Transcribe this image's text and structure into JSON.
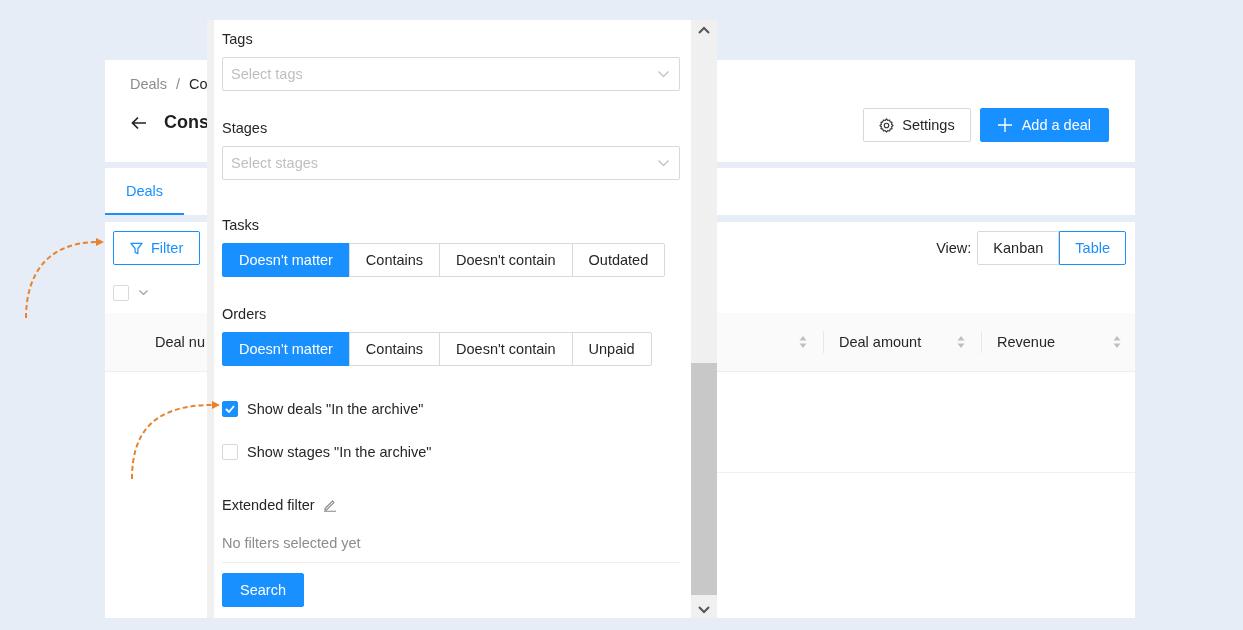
{
  "breadcrumb": [
    {
      "label": "Deals"
    },
    {
      "label": "Co",
      "separator": "/"
    }
  ],
  "page_title": "Cons",
  "header_buttons": [
    {
      "label": "Settings",
      "kind": "settings"
    },
    {
      "label": "Add a deal",
      "kind": "add"
    }
  ],
  "tabs": [
    {
      "label": "Deals",
      "selected": true
    }
  ],
  "filter_button": "Filter",
  "view": {
    "label": "View:",
    "options": [
      {
        "label": "Kanban",
        "selected": false
      },
      {
        "label": "Table",
        "selected": true
      }
    ]
  },
  "select_all": {
    "checked": false
  },
  "table": {
    "columns": [
      {
        "label": "Deal nu"
      },
      {
        "label": "Deal amount"
      },
      {
        "label": "Revenue"
      }
    ]
  },
  "filter_panel": {
    "fields": [
      {
        "label": "Tags",
        "placeholder": "Select tags"
      },
      {
        "label": "Stages",
        "placeholder": "Select stages"
      }
    ],
    "groups": [
      {
        "label": "Tasks",
        "options": [
          {
            "label": "Doesn't matter",
            "selected": true
          },
          {
            "label": "Contains",
            "selected": false
          },
          {
            "label": "Doesn't contain",
            "selected": false
          },
          {
            "label": "Outdated",
            "selected": false
          }
        ]
      },
      {
        "label": "Orders",
        "options": [
          {
            "label": "Doesn't matter",
            "selected": true
          },
          {
            "label": "Contains",
            "selected": false
          },
          {
            "label": "Doesn't contain",
            "selected": false
          },
          {
            "label": "Unpaid",
            "selected": false
          }
        ]
      }
    ],
    "checkboxes": [
      {
        "label": "Show deals \"In the archive\"",
        "checked": true
      },
      {
        "label": "Show stages \"In the archive\"",
        "checked": false
      }
    ],
    "extended_filter": {
      "label": "Extended filter",
      "empty_text": "No filters selected yet"
    },
    "search_button": "Search"
  }
}
